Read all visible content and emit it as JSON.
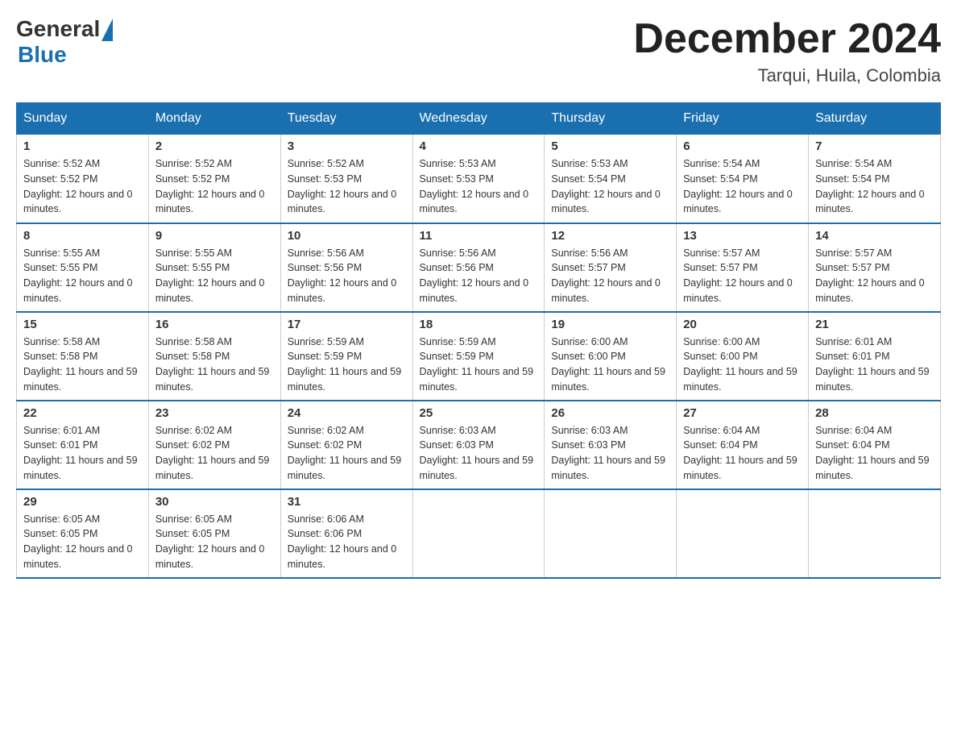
{
  "header": {
    "logo_general": "General",
    "logo_blue": "Blue",
    "month_title": "December 2024",
    "location": "Tarqui, Huila, Colombia"
  },
  "days_of_week": [
    "Sunday",
    "Monday",
    "Tuesday",
    "Wednesday",
    "Thursday",
    "Friday",
    "Saturday"
  ],
  "weeks": [
    [
      {
        "day": "1",
        "sunrise": "5:52 AM",
        "sunset": "5:52 PM",
        "daylight": "12 hours and 0 minutes."
      },
      {
        "day": "2",
        "sunrise": "5:52 AM",
        "sunset": "5:52 PM",
        "daylight": "12 hours and 0 minutes."
      },
      {
        "day": "3",
        "sunrise": "5:52 AM",
        "sunset": "5:53 PM",
        "daylight": "12 hours and 0 minutes."
      },
      {
        "day": "4",
        "sunrise": "5:53 AM",
        "sunset": "5:53 PM",
        "daylight": "12 hours and 0 minutes."
      },
      {
        "day": "5",
        "sunrise": "5:53 AM",
        "sunset": "5:54 PM",
        "daylight": "12 hours and 0 minutes."
      },
      {
        "day": "6",
        "sunrise": "5:54 AM",
        "sunset": "5:54 PM",
        "daylight": "12 hours and 0 minutes."
      },
      {
        "day": "7",
        "sunrise": "5:54 AM",
        "sunset": "5:54 PM",
        "daylight": "12 hours and 0 minutes."
      }
    ],
    [
      {
        "day": "8",
        "sunrise": "5:55 AM",
        "sunset": "5:55 PM",
        "daylight": "12 hours and 0 minutes."
      },
      {
        "day": "9",
        "sunrise": "5:55 AM",
        "sunset": "5:55 PM",
        "daylight": "12 hours and 0 minutes."
      },
      {
        "day": "10",
        "sunrise": "5:56 AM",
        "sunset": "5:56 PM",
        "daylight": "12 hours and 0 minutes."
      },
      {
        "day": "11",
        "sunrise": "5:56 AM",
        "sunset": "5:56 PM",
        "daylight": "12 hours and 0 minutes."
      },
      {
        "day": "12",
        "sunrise": "5:56 AM",
        "sunset": "5:57 PM",
        "daylight": "12 hours and 0 minutes."
      },
      {
        "day": "13",
        "sunrise": "5:57 AM",
        "sunset": "5:57 PM",
        "daylight": "12 hours and 0 minutes."
      },
      {
        "day": "14",
        "sunrise": "5:57 AM",
        "sunset": "5:57 PM",
        "daylight": "12 hours and 0 minutes."
      }
    ],
    [
      {
        "day": "15",
        "sunrise": "5:58 AM",
        "sunset": "5:58 PM",
        "daylight": "11 hours and 59 minutes."
      },
      {
        "day": "16",
        "sunrise": "5:58 AM",
        "sunset": "5:58 PM",
        "daylight": "11 hours and 59 minutes."
      },
      {
        "day": "17",
        "sunrise": "5:59 AM",
        "sunset": "5:59 PM",
        "daylight": "11 hours and 59 minutes."
      },
      {
        "day": "18",
        "sunrise": "5:59 AM",
        "sunset": "5:59 PM",
        "daylight": "11 hours and 59 minutes."
      },
      {
        "day": "19",
        "sunrise": "6:00 AM",
        "sunset": "6:00 PM",
        "daylight": "11 hours and 59 minutes."
      },
      {
        "day": "20",
        "sunrise": "6:00 AM",
        "sunset": "6:00 PM",
        "daylight": "11 hours and 59 minutes."
      },
      {
        "day": "21",
        "sunrise": "6:01 AM",
        "sunset": "6:01 PM",
        "daylight": "11 hours and 59 minutes."
      }
    ],
    [
      {
        "day": "22",
        "sunrise": "6:01 AM",
        "sunset": "6:01 PM",
        "daylight": "11 hours and 59 minutes."
      },
      {
        "day": "23",
        "sunrise": "6:02 AM",
        "sunset": "6:02 PM",
        "daylight": "11 hours and 59 minutes."
      },
      {
        "day": "24",
        "sunrise": "6:02 AM",
        "sunset": "6:02 PM",
        "daylight": "11 hours and 59 minutes."
      },
      {
        "day": "25",
        "sunrise": "6:03 AM",
        "sunset": "6:03 PM",
        "daylight": "11 hours and 59 minutes."
      },
      {
        "day": "26",
        "sunrise": "6:03 AM",
        "sunset": "6:03 PM",
        "daylight": "11 hours and 59 minutes."
      },
      {
        "day": "27",
        "sunrise": "6:04 AM",
        "sunset": "6:04 PM",
        "daylight": "11 hours and 59 minutes."
      },
      {
        "day": "28",
        "sunrise": "6:04 AM",
        "sunset": "6:04 PM",
        "daylight": "11 hours and 59 minutes."
      }
    ],
    [
      {
        "day": "29",
        "sunrise": "6:05 AM",
        "sunset": "6:05 PM",
        "daylight": "12 hours and 0 minutes."
      },
      {
        "day": "30",
        "sunrise": "6:05 AM",
        "sunset": "6:05 PM",
        "daylight": "12 hours and 0 minutes."
      },
      {
        "day": "31",
        "sunrise": "6:06 AM",
        "sunset": "6:06 PM",
        "daylight": "12 hours and 0 minutes."
      },
      null,
      null,
      null,
      null
    ]
  ]
}
